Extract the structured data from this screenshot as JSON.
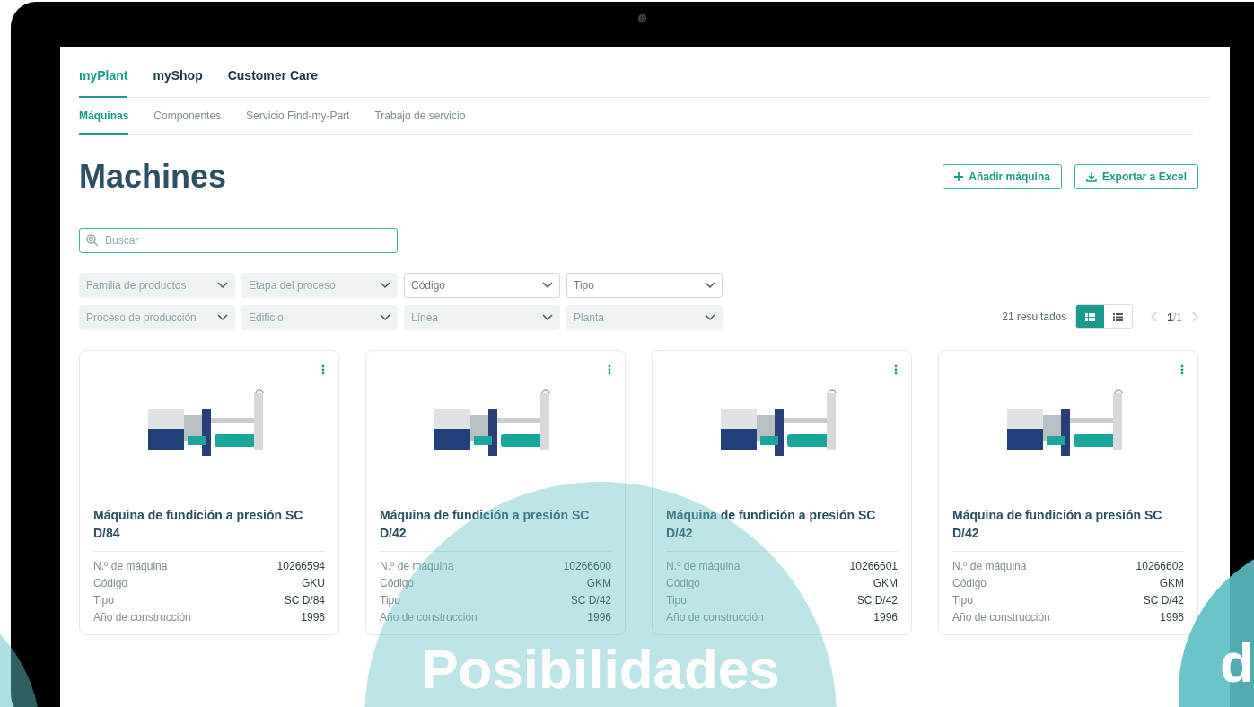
{
  "main_tabs": [
    {
      "label": "myPlant",
      "selected": true
    },
    {
      "label": "myShop",
      "selected": false
    },
    {
      "label": "Customer Care",
      "selected": false
    }
  ],
  "sub_tabs": [
    {
      "label": "Máquinas",
      "selected": true
    },
    {
      "label": "Componentes",
      "selected": false
    },
    {
      "label": "Servicio Find-my-Part",
      "selected": false
    },
    {
      "label": "Trabajo de servicio",
      "selected": false
    }
  ],
  "page_title": "Machines",
  "actions": [
    {
      "kind": "add",
      "label": "Añadir máquina"
    },
    {
      "kind": "export",
      "label": "Exportar a Excel"
    }
  ],
  "search": {
    "placeholder": "Buscar"
  },
  "filters": [
    {
      "label": "Familia de productos",
      "disabled": true
    },
    {
      "label": "Etapa del proceso",
      "disabled": true
    },
    {
      "label": "Código",
      "disabled": false
    },
    {
      "label": "Tipo",
      "disabled": false
    },
    {
      "label": "Proceso de producción",
      "disabled": true
    },
    {
      "label": "Edificio",
      "disabled": true
    },
    {
      "label": "Línea",
      "disabled": true
    },
    {
      "label": "Planta",
      "disabled": true
    }
  ],
  "results": "21 resultados",
  "views": [
    {
      "kind": "grid",
      "selected": true
    },
    {
      "kind": "list",
      "selected": false
    }
  ],
  "pagination": {
    "current": "1",
    "total": "/1"
  },
  "cards": [
    {
      "title": "Máquina de fundición a presión SC D/84",
      "fields": [
        {
          "label": "N.º de máquina",
          "value": "10266594"
        },
        {
          "label": "Código",
          "value": "GKU"
        },
        {
          "label": "Tipo",
          "value": "SC D/84"
        },
        {
          "label": "Año de construcción",
          "value": "1996"
        }
      ]
    },
    {
      "title": "Máquina de fundición a presión SC D/42",
      "fields": [
        {
          "label": "N.º de máquina",
          "value": "10266600"
        },
        {
          "label": "Código",
          "value": "GKM"
        },
        {
          "label": "Tipo",
          "value": "SC D/42"
        },
        {
          "label": "Año de construcción",
          "value": "1996"
        }
      ]
    },
    {
      "title": "Máquina de fundición a presión SC D/42",
      "fields": [
        {
          "label": "N.º de máquina",
          "value": "10266601"
        },
        {
          "label": "Código",
          "value": "GKM"
        },
        {
          "label": "Tipo",
          "value": "SC D/42"
        },
        {
          "label": "Año de construcción",
          "value": "1996"
        }
      ]
    },
    {
      "title": "Máquina de fundición a presión SC D/42",
      "fields": [
        {
          "label": "N.º de máquina",
          "value": "10266602"
        },
        {
          "label": "Código",
          "value": "GKM"
        },
        {
          "label": "Tipo",
          "value": "SC D/42"
        },
        {
          "label": "Año de construcción",
          "value": "1996"
        }
      ]
    }
  ],
  "overlay_texts": [
    "Posibilidades",
    "d"
  ]
}
